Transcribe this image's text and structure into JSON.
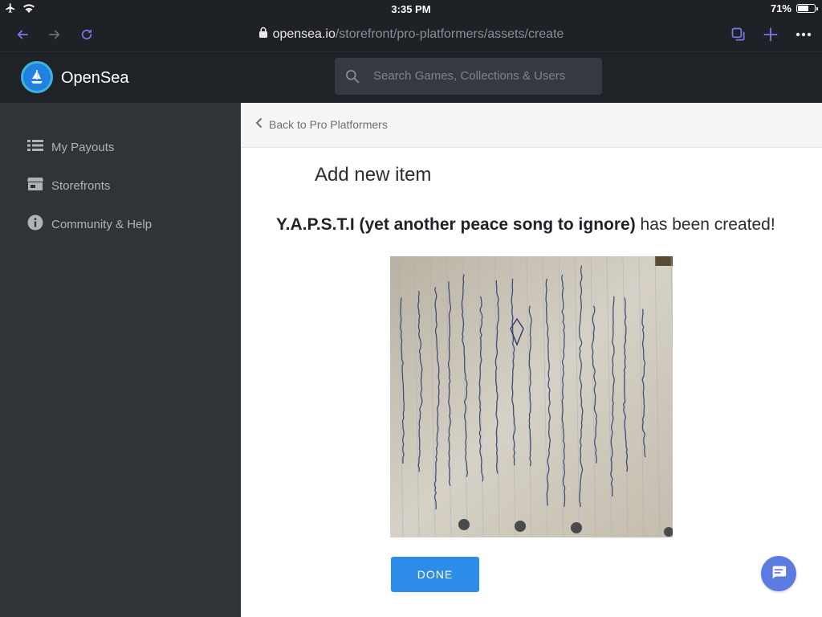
{
  "statusbar": {
    "time": "3:35 PM",
    "battery": "71%",
    "battery_level": 0.71
  },
  "browser": {
    "url_domain": "opensea.io",
    "url_path": "/storefront/pro-platformers/assets/create",
    "icons": [
      "back-arrow-icon",
      "forward-arrow-icon",
      "reload-icon",
      "tabs-icon",
      "plus-icon",
      "more-icon"
    ]
  },
  "header": {
    "brand": "OpenSea",
    "search": {
      "placeholder": "Search Games, Collections & Users"
    }
  },
  "sidebar": {
    "items": [
      {
        "label": "My Payouts",
        "icon": "list-icon"
      },
      {
        "label": "Storefronts",
        "icon": "storefront-icon"
      },
      {
        "label": "Community & Help",
        "icon": "info-icon"
      }
    ]
  },
  "main": {
    "back_link": "Back to Pro Platformers",
    "title": "Add new item",
    "created_name": "Y.A.P.S.T.I (yet another peace song to ignore)",
    "created_suffix": " has been created!",
    "done_label": "DONE"
  },
  "colors": {
    "accent": "#2d8ce8",
    "browser_icon": "#7b7bf0",
    "header_bg": "#1f2327",
    "sidebar_bg": "#2f3439",
    "chat_bg": "#5b7be0"
  }
}
